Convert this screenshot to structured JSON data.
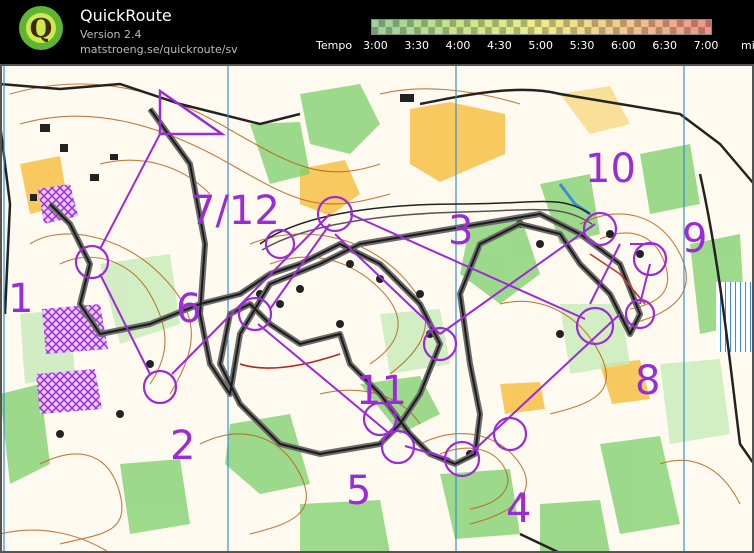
{
  "app": {
    "title": "QuickRoute",
    "version": "Version 2.4",
    "url": "matstroeng.se/quickroute/sv",
    "logo_letter": "Q"
  },
  "legend": {
    "label": "Tempo",
    "ticks": [
      "3:00",
      "3:30",
      "4:00",
      "4:30",
      "5:00",
      "5:30",
      "6:00",
      "6:30",
      "7:00"
    ],
    "unit": "min/km",
    "colors": [
      "#9bd19b",
      "#c8e68a",
      "#eeee8a",
      "#f4c98a",
      "#f0958a"
    ]
  },
  "controls": [
    "1",
    "2",
    "3",
    "4",
    "5",
    "6",
    "7/12",
    "8",
    "9",
    "10",
    "11"
  ],
  "colors": {
    "course": "#9a2bd6",
    "route": "#1a1a1a",
    "route_outline": "#6c6c6c",
    "forest": "#8fd17a",
    "open": "#f5c242",
    "contour": "#b8651c",
    "water": "#7fc8e8",
    "building": "#222222",
    "paper": "#fffaf0"
  }
}
